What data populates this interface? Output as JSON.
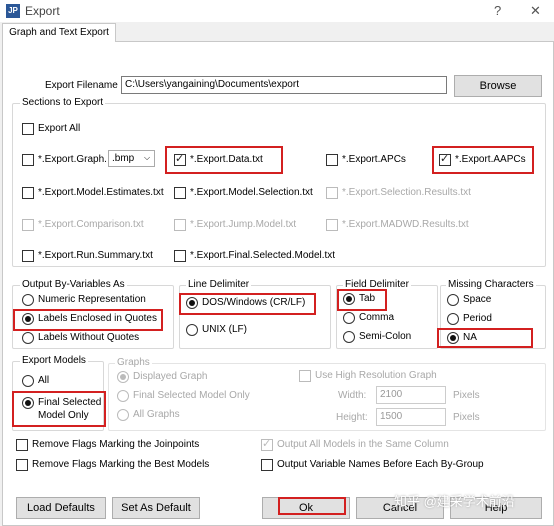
{
  "window": {
    "icon_text": "JP",
    "title": "Export",
    "help": "?",
    "close": "✕"
  },
  "tab": "Graph and Text Export",
  "filename": {
    "label": "Export Filename",
    "value": "C:\\Users\\yangaining\\Documents\\export",
    "browse": "Browse"
  },
  "sections": {
    "title": "Sections to Export",
    "export_all": "Export All",
    "graph": "*.Export.Graph.",
    "graph_format": ".bmp",
    "data": "*.Export.Data.txt",
    "apcs": "*.Export.APCs",
    "aapcs": "*.Export.AAPCs",
    "model_estimates": "*.Export.Model.Estimates.txt",
    "model_selection": "*.Export.Model.Selection.txt",
    "selection_results": "*.Export.Selection.Results.txt",
    "comparison": "*.Export.Comparison.txt",
    "jump_model": "*.Export.Jump.Model.txt",
    "madwd": "*.Export.MADWD.Results.txt",
    "run_summary": "*.Export.Run.Summary.txt",
    "final_selected": "*.Export.Final.Selected.Model.txt"
  },
  "output_by": {
    "title": "Output By-Variables As",
    "numeric": "Numeric Representation",
    "enclosed": "Labels Enclosed in Quotes",
    "without": "Labels Without Quotes"
  },
  "line_delim": {
    "title": "Line Delimiter",
    "dos": "DOS/Windows (CR/LF)",
    "unix": "UNIX (LF)"
  },
  "field_delim": {
    "title": "Field Delimiter",
    "tab": "Tab",
    "comma": "Comma",
    "semicolon": "Semi-Colon"
  },
  "missing": {
    "title": "Missing Characters",
    "space": "Space",
    "period": "Period",
    "na": "NA"
  },
  "export_models": {
    "title": "Export Models",
    "all": "All",
    "final_line1": "Final Selected",
    "final_line2": "Model Only"
  },
  "graphs": {
    "title": "Graphs",
    "displayed": "Displayed Graph",
    "final": "Final Selected Model Only",
    "all": "All Graphs",
    "high_res": "Use High Resolution Graph",
    "width_label": "Width:",
    "width_value": "2100",
    "height_label": "Height:",
    "height_value": "1500",
    "pixels": "Pixels"
  },
  "options": {
    "remove_joinpoints": "Remove Flags Marking the Joinpoints",
    "remove_best": "Remove Flags Marking the Best Models",
    "output_same_column": "Output All Models in the Same Column",
    "output_varnames": "Output Variable Names Before Each By-Group"
  },
  "buttons": {
    "load": "Load Defaults",
    "save": "Set As Default",
    "ok": "Ok",
    "cancel": "Cancel",
    "help": "Help"
  },
  "watermark": "知乎 @建采学术前沿"
}
